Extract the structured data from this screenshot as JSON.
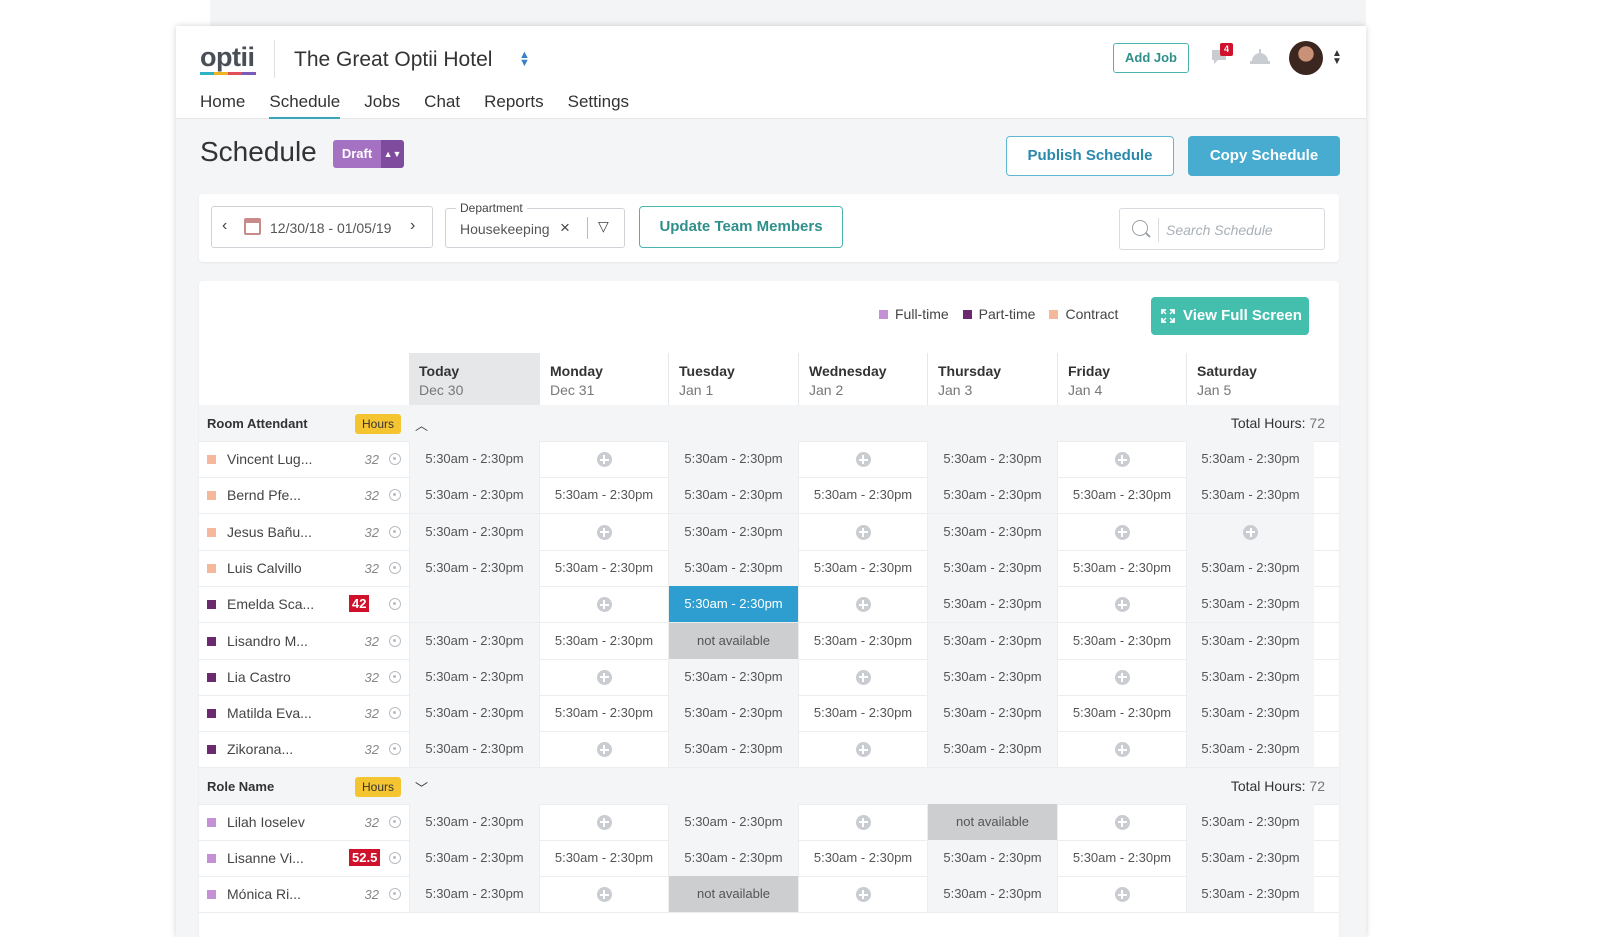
{
  "app": {
    "logo": "optii",
    "hotel_name": "The Great Optii Hotel",
    "add_job_label": "Add Job",
    "chat_badge": "4",
    "nav": [
      "Home",
      "Schedule",
      "Jobs",
      "Chat",
      "Reports",
      "Settings"
    ],
    "nav_active": "Schedule"
  },
  "page": {
    "title": "Schedule",
    "status": "Draft",
    "publish_label": "Publish Schedule",
    "copy_label": "Copy Schedule"
  },
  "filters": {
    "date_range": "12/30/18 - 01/05/19",
    "department_label": "Department",
    "department_value": "Housekeeping",
    "update_label": "Update Team Members",
    "search_placeholder": "Search Schedule"
  },
  "legend": [
    {
      "label": "Full-time",
      "color": "#c490d6"
    },
    {
      "label": "Part-time",
      "color": "#6b2a6e"
    },
    {
      "label": "Contract",
      "color": "#f5b89a"
    }
  ],
  "view_full_screen_label": "View Full Screen",
  "days": [
    {
      "name": "Today",
      "date": "Dec 30"
    },
    {
      "name": "Monday",
      "date": "Dec 31"
    },
    {
      "name": "Tuesday",
      "date": "Jan 1"
    },
    {
      "name": "Wednesday",
      "date": "Jan 2"
    },
    {
      "name": "Thursday",
      "date": "Jan 3"
    },
    {
      "name": "Friday",
      "date": "Jan 4"
    },
    {
      "name": "Saturday",
      "date": "Jan 5"
    }
  ],
  "groups": [
    {
      "name": "Room Attendant",
      "hours_label": "Hours",
      "total_label": "Total Hours:",
      "total_value": "72",
      "expanded": true,
      "employees": [
        {
          "name": "Vincent Lug...",
          "type": "Contract",
          "hours": "32",
          "over": false,
          "shifts": [
            "5:30am - 2:30pm",
            "+",
            "5:30am - 2:30pm",
            "+",
            "5:30am - 2:30pm",
            "+",
            "5:30am - 2:30pm"
          ]
        },
        {
          "name": "Bernd Pfe...",
          "type": "Contract",
          "hours": "32",
          "over": false,
          "shifts": [
            "5:30am - 2:30pm",
            "5:30am - 2:30pm",
            "5:30am - 2:30pm",
            "5:30am - 2:30pm",
            "5:30am - 2:30pm",
            "5:30am - 2:30pm",
            "5:30am - 2:30pm"
          ]
        },
        {
          "name": "Jesus Bañu...",
          "type": "Contract",
          "hours": "32",
          "over": false,
          "shifts": [
            "5:30am - 2:30pm",
            "+",
            "5:30am - 2:30pm",
            "+",
            "5:30am - 2:30pm",
            "+",
            "+"
          ]
        },
        {
          "name": "Luis Calvillo",
          "type": "Contract",
          "hours": "32",
          "over": false,
          "shifts": [
            "5:30am - 2:30pm",
            "5:30am - 2:30pm",
            "5:30am - 2:30pm",
            "5:30am - 2:30pm",
            "5:30am - 2:30pm",
            "5:30am - 2:30pm",
            "5:30am - 2:30pm"
          ]
        },
        {
          "name": "Emelda Sca...",
          "type": "Part-time",
          "hours": "42",
          "over": true,
          "shifts": [
            "",
            "+",
            "5:30am - 2:30pm*",
            "+",
            "5:30am - 2:30pm",
            "+",
            "5:30am - 2:30pm"
          ]
        },
        {
          "name": "Lisandro M...",
          "type": "Part-time",
          "hours": "32",
          "over": false,
          "shifts": [
            "5:30am - 2:30pm",
            "5:30am - 2:30pm",
            "not available",
            "5:30am - 2:30pm",
            "5:30am - 2:30pm",
            "5:30am - 2:30pm",
            "5:30am - 2:30pm"
          ]
        },
        {
          "name": "Lia Castro",
          "type": "Part-time",
          "hours": "32",
          "over": false,
          "shifts": [
            "5:30am - 2:30pm",
            "+",
            "5:30am - 2:30pm",
            "+",
            "5:30am - 2:30pm",
            "+",
            "5:30am - 2:30pm"
          ]
        },
        {
          "name": "Matilda Eva...",
          "type": "Part-time",
          "hours": "32",
          "over": false,
          "shifts": [
            "5:30am - 2:30pm",
            "5:30am - 2:30pm",
            "5:30am - 2:30pm",
            "5:30am - 2:30pm",
            "5:30am - 2:30pm",
            "5:30am - 2:30pm",
            "5:30am - 2:30pm"
          ]
        },
        {
          "name": "Zikorana...",
          "type": "Part-time",
          "hours": "32",
          "over": false,
          "shifts": [
            "5:30am - 2:30pm",
            "+",
            "5:30am - 2:30pm",
            "+",
            "5:30am - 2:30pm",
            "+",
            "5:30am - 2:30pm"
          ]
        }
      ]
    },
    {
      "name": "Role Name",
      "hours_label": "Hours",
      "total_label": "Total Hours:",
      "total_value": "72",
      "expanded": false,
      "employees": [
        {
          "name": "Lilah Ioselev",
          "type": "Full-time",
          "hours": "32",
          "over": false,
          "shifts": [
            "5:30am - 2:30pm",
            "+",
            "5:30am - 2:30pm",
            "+",
            "not available",
            "+",
            "5:30am - 2:30pm"
          ]
        },
        {
          "name": "Lisanne Vi...",
          "type": "Full-time",
          "hours": "52.5",
          "over": true,
          "shifts": [
            "5:30am - 2:30pm",
            "5:30am - 2:30pm",
            "5:30am - 2:30pm",
            "5:30am - 2:30pm",
            "5:30am - 2:30pm",
            "5:30am - 2:30pm",
            "5:30am - 2:30pm"
          ]
        },
        {
          "name": "Mónica Ri...",
          "type": "Full-time",
          "hours": "32",
          "over": false,
          "shifts": [
            "5:30am - 2:30pm",
            "+",
            "not available",
            "+",
            "5:30am - 2:30pm",
            "+",
            "5:30am - 2:30pm"
          ]
        }
      ]
    }
  ]
}
